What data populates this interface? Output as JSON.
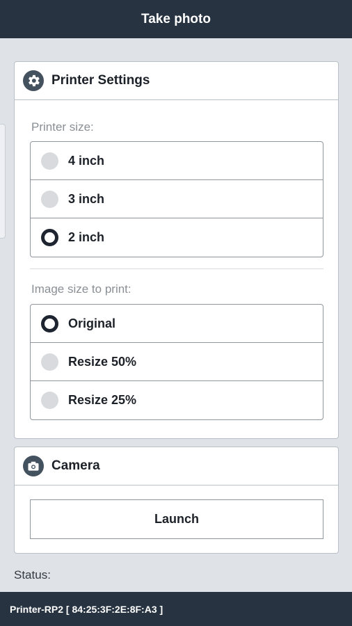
{
  "header": {
    "title": "Take photo"
  },
  "printer_settings": {
    "title": "Printer Settings",
    "icon": "gear-icon",
    "printer_size": {
      "label": "Printer size:",
      "options": [
        {
          "label": "4 inch",
          "selected": false
        },
        {
          "label": "3 inch",
          "selected": false
        },
        {
          "label": "2 inch",
          "selected": true
        }
      ]
    },
    "image_size": {
      "label": "Image size to print:",
      "options": [
        {
          "label": "Original",
          "selected": true
        },
        {
          "label": "Resize 50%",
          "selected": false
        },
        {
          "label": "Resize 25%",
          "selected": false
        }
      ]
    }
  },
  "camera": {
    "title": "Camera",
    "icon": "camera-icon",
    "launch_label": "Launch"
  },
  "status": {
    "label": "Status:"
  },
  "footer": {
    "device": "Printer-RP2 [ 84:25:3F:2E:8F:A3 ]"
  },
  "colors": {
    "bar": "#273340",
    "background": "#dfe3e7",
    "radio_checked": "#1e2530",
    "radio_unchecked": "#d8dadd"
  }
}
